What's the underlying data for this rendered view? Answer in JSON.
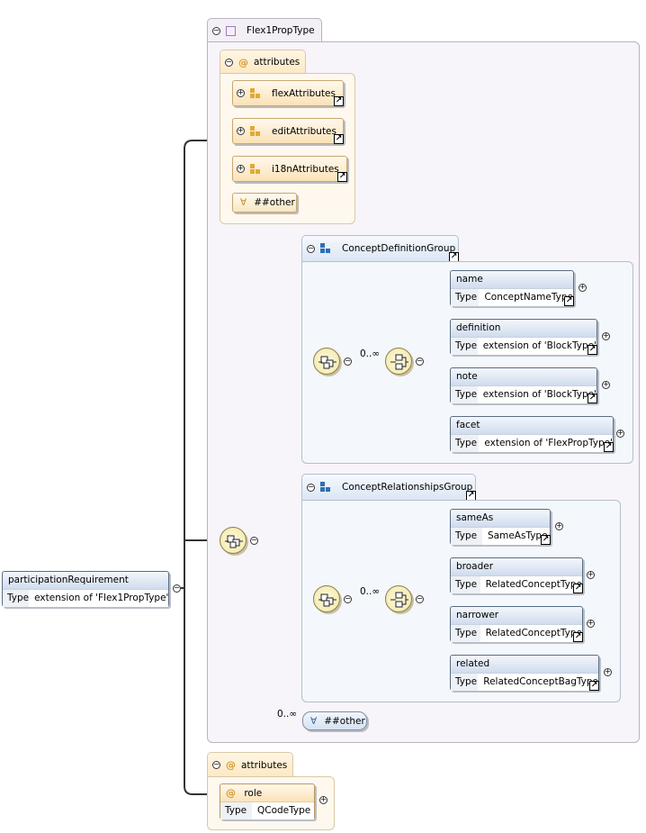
{
  "root": {
    "element": {
      "name": "participationRequirement",
      "type_label": "Type",
      "type_value": "extension of 'Flex1PropType'"
    }
  },
  "flex1": {
    "name": "Flex1PropType",
    "attributes": {
      "title": "attributes",
      "groups": [
        "flexAttributes",
        "editAttributes",
        "i18nAttributes"
      ],
      "any": "##other"
    },
    "concept_definition": {
      "title": "ConceptDefinitionGroup",
      "cardinality": "0..∞",
      "elements": [
        {
          "name": "name",
          "type_label": "Type",
          "type_value": "ConceptNameType"
        },
        {
          "name": "definition",
          "type_label": "Type",
          "type_value": "extension of 'BlockType'"
        },
        {
          "name": "note",
          "type_label": "Type",
          "type_value": "extension of 'BlockType'"
        },
        {
          "name": "facet",
          "type_label": "Type",
          "type_value": "extension of 'FlexPropType'"
        }
      ]
    },
    "concept_relationships": {
      "title": "ConceptRelationshipsGroup",
      "cardinality": "0..∞",
      "elements": [
        {
          "name": "sameAs",
          "type_label": "Type",
          "type_value": "SameAsType"
        },
        {
          "name": "broader",
          "type_label": "Type",
          "type_value": "RelatedConceptType"
        },
        {
          "name": "narrower",
          "type_label": "Type",
          "type_value": "RelatedConceptType"
        },
        {
          "name": "related",
          "type_label": "Type",
          "type_value": "RelatedConceptBagType"
        }
      ]
    },
    "any_cardinality": "0..∞",
    "any": "##other"
  },
  "bottom_attributes": {
    "title": "attributes",
    "attr": {
      "name": "role",
      "type_label": "Type",
      "type_value": "QCodeType"
    }
  },
  "colors": {
    "line": "#333333",
    "thin_line": "#cccccc",
    "frame": "#b9b2c2"
  }
}
